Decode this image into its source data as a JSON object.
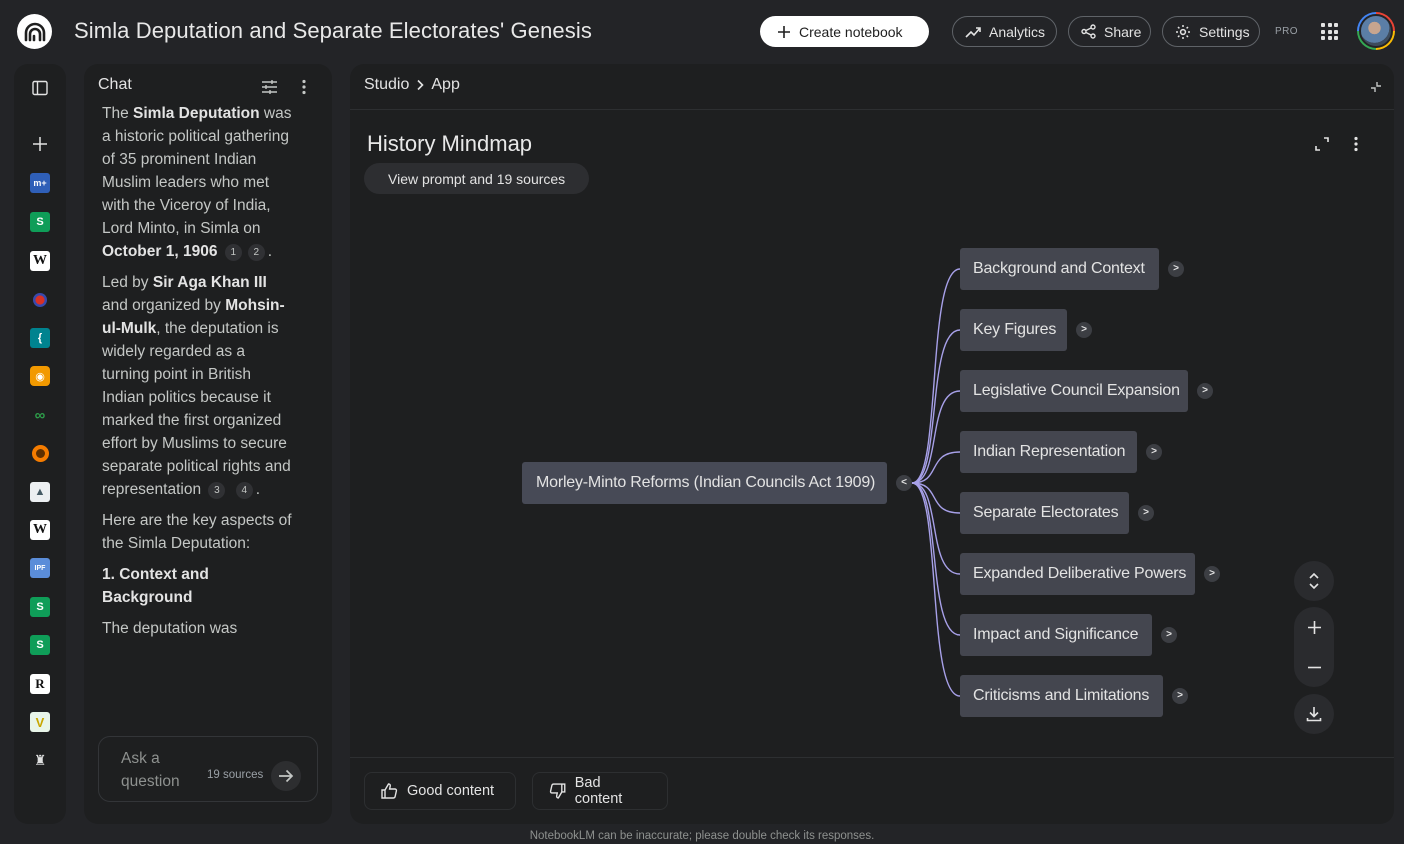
{
  "header": {
    "title": "Simla Deputation and Separate Electorates' Genesis",
    "create_label": "Create notebook",
    "analytics_label": "Analytics",
    "share_label": "Share",
    "settings_label": "Settings",
    "pro_label": "PRO"
  },
  "rail": {
    "items": [
      {
        "icon": "panel-toggle-icon"
      },
      {
        "icon": "add-source-icon"
      },
      {
        "icon": "source-favicon-blue",
        "color": "#4a7ee0",
        "glyph": "m"
      },
      {
        "icon": "source-favicon-sheets",
        "color": "#0f9d58",
        "glyph": "[S]"
      },
      {
        "icon": "source-favicon-wikipedia",
        "color": "#ffffff",
        "glyph": "W"
      },
      {
        "icon": "source-favicon-red",
        "color": "#d93025",
        "glyph": "●"
      },
      {
        "icon": "source-favicon-teal",
        "color": "#00838f",
        "glyph": "{"
      },
      {
        "icon": "source-favicon-orange",
        "color": "#f29900",
        "glyph": "◉"
      },
      {
        "icon": "source-favicon-green",
        "color": "#2e7d32",
        "glyph": "∞"
      },
      {
        "icon": "source-favicon-orange-ring",
        "color": "#f57c00",
        "glyph": "◎"
      },
      {
        "icon": "source-favicon-mountain",
        "color": "#cfd8dc",
        "glyph": "▲"
      },
      {
        "icon": "source-favicon-wikipedia",
        "color": "#ffffff",
        "glyph": "W"
      },
      {
        "icon": "source-favicon-ipf",
        "color": "#5b8dd9",
        "glyph": "IPF"
      },
      {
        "icon": "source-favicon-sheets",
        "color": "#0f9d58",
        "glyph": "[S]"
      },
      {
        "icon": "source-favicon-sheets",
        "color": "#0f9d58",
        "glyph": "[S]"
      },
      {
        "icon": "source-favicon-r",
        "color": "#ffffff",
        "glyph": "R"
      },
      {
        "icon": "source-favicon-v",
        "color": "#c5e1a5",
        "glyph": "V"
      },
      {
        "icon": "source-favicon-emblem",
        "color": "#e0e0e0",
        "glyph": "♜"
      }
    ]
  },
  "chat": {
    "title": "Chat",
    "p1_a": "The ",
    "p1_b": "Simla Deputation",
    "p1_c": " was a historic political gathering of 35 prominent Indian Muslim leaders who met with the Viceroy of India, Lord Minto, in Simla on ",
    "p1_d": "October 1, 1906",
    "cite1": "1",
    "cite2": "2",
    "p2_a": "Led by ",
    "p2_b": "Sir Aga Khan III",
    "p2_c": " and organized by ",
    "p2_d": "Mohsin-ul-Mulk",
    "p2_e": ", the deputation is widely regarded as a turning point in British Indian politics because it marked the first organized effort by Muslims to secure separate political rights and representation",
    "cite3": "3",
    "cite4": "4",
    "p3": "Here are the key aspects of the Simla Deputation:",
    "heading": "1. Context and Background",
    "p4": "The deputation was",
    "ask_placeholder": "Ask a question",
    "sources_count": "19 sources"
  },
  "studio": {
    "crumb_studio": "Studio",
    "crumb_app": "App",
    "mindmap_title": "History Mindmap",
    "view_prompt": "View prompt and 19 sources",
    "root": "Morley-Minto Reforms (Indian Councils Act 1909)",
    "root_toggle": "<",
    "child_toggle": ">",
    "children": [
      "Background and Context",
      "Key Figures",
      "Legislative Council Expansion",
      "Indian Representation",
      "Separate Electorates",
      "Expanded Deliberative Powers",
      "Impact and Significance",
      "Criticisms and Limitations"
    ],
    "good_label": "Good content",
    "bad_label": "Bad content"
  },
  "footer": {
    "disclaimer": "NotebookLM can be inaccurate; please double check its responses."
  },
  "colors": {
    "background": "#232427",
    "panel": "#1e1f20",
    "node": "#44464f",
    "connector": "#a7a0e8"
  }
}
